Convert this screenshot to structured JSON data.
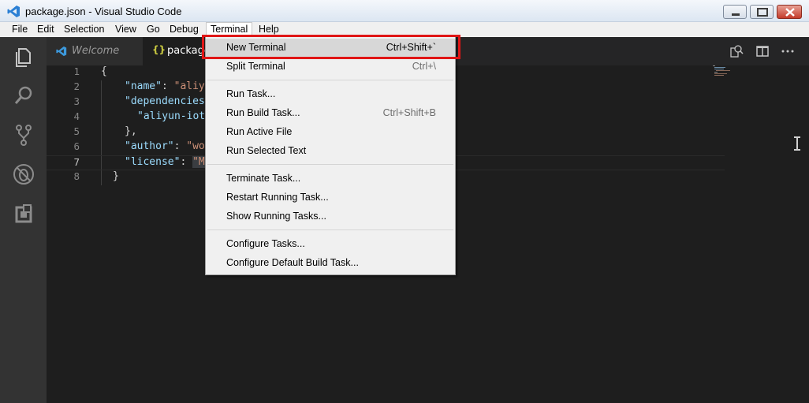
{
  "window": {
    "title": "package.json - Visual Studio Code"
  },
  "menubar": {
    "items": [
      "File",
      "Edit",
      "Selection",
      "View",
      "Go",
      "Debug",
      "Terminal",
      "Help"
    ],
    "open_menu": "Terminal"
  },
  "tabs": [
    {
      "label": "Welcome",
      "icon": "vscode-icon"
    },
    {
      "label": "package",
      "icon": "json-braces-icon",
      "braces": "{}"
    }
  ],
  "editor": {
    "lines": [
      {
        "num": "1",
        "text": "{"
      },
      {
        "num": "2",
        "key": "\"name\"",
        "sep": ": ",
        "val": "\"aliyu"
      },
      {
        "num": "3",
        "key": "\"dependencies\"",
        "sep": "",
        "val": ""
      },
      {
        "num": "4",
        "key": "",
        "sep": "",
        "val": "\"aliyun-iot"
      },
      {
        "num": "5",
        "text": "},"
      },
      {
        "num": "6",
        "key": "\"author\"",
        "sep": ": ",
        "val": "\"wo"
      },
      {
        "num": "7",
        "key": "\"license\"",
        "sep": ": ",
        "val": "\"M"
      },
      {
        "num": "8",
        "text": "}"
      }
    ],
    "current_line": "7"
  },
  "terminal_menu": {
    "groups": [
      [
        {
          "label": "New Terminal",
          "shortcut": "Ctrl+Shift+`"
        },
        {
          "label": "Split Terminal",
          "shortcut": "Ctrl+\\"
        }
      ],
      [
        {
          "label": "Run Task...",
          "shortcut": ""
        },
        {
          "label": "Run Build Task...",
          "shortcut": "Ctrl+Shift+B"
        },
        {
          "label": "Run Active File",
          "shortcut": ""
        },
        {
          "label": "Run Selected Text",
          "shortcut": ""
        }
      ],
      [
        {
          "label": "Terminate Task...",
          "shortcut": ""
        },
        {
          "label": "Restart Running Task...",
          "shortcut": ""
        },
        {
          "label": "Show Running Tasks...",
          "shortcut": ""
        }
      ],
      [
        {
          "label": "Configure Tasks...",
          "shortcut": ""
        },
        {
          "label": "Configure Default Build Task...",
          "shortcut": ""
        }
      ]
    ],
    "highlighted_item": "New Terminal"
  },
  "activitybar": {
    "icons": [
      "explorer-icon",
      "search-icon",
      "source-control-icon",
      "debug-icon",
      "extensions-icon"
    ]
  },
  "colors": {
    "accent_highlight": "#e01616",
    "editor_bg": "#1e1e1e",
    "activitybar_bg": "#333333",
    "json_key": "#9cdcfe",
    "json_string": "#ce9178",
    "braces": "#cbcb41"
  }
}
